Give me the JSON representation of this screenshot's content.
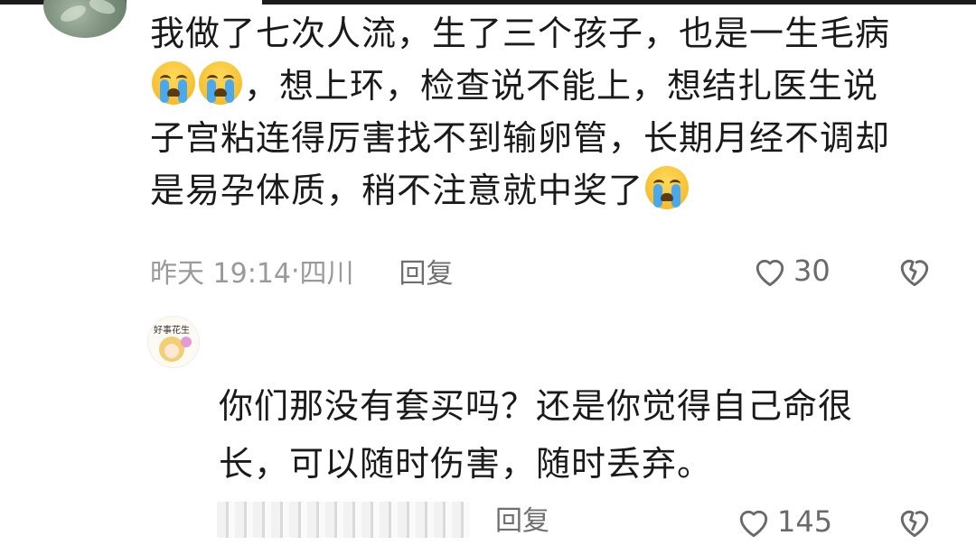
{
  "comment1": {
    "text_line1": "我做了七次人流，生了三个孩子，也是一生毛病",
    "text_line2_after_emoji": "，想上环，检查说不能上，想结扎医生说",
    "text_line3": "子宫粘连得厉害找不到输卵管，长期月经不调却",
    "text_line4": "是易孕体质，稍不注意就中奖了",
    "emoji_icon": "crying-face-icon",
    "time": "昨天 19:14",
    "location_sep": "·",
    "location": "四川",
    "reply_label": "回复",
    "like_count": "30"
  },
  "comment2": {
    "avatar_text": "好事花生",
    "text_line1": "你们那没有套买吗？还是你觉得自己命很",
    "text_line2": "长，可以随时伤害，随时丢弃。",
    "reply_label": "回复",
    "like_count": "145"
  },
  "colors": {
    "text": "#1a1a1a",
    "meta": "#9a9a9a",
    "icon": "#6a6a6a"
  }
}
